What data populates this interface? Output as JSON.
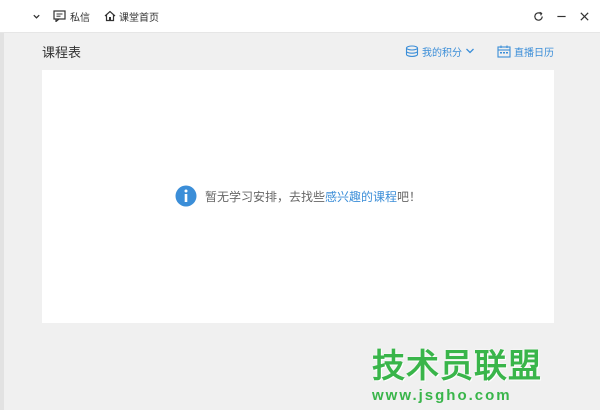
{
  "titlebar": {
    "messages_label": "私信",
    "home_label": "课堂首页",
    "icons": [
      "chevron-down-icon",
      "message-icon",
      "home-icon",
      "refresh-icon",
      "minimize-icon",
      "close-icon"
    ]
  },
  "header": {
    "title": "课程表",
    "points_label": "我的积分",
    "calendar_label": "直播日历"
  },
  "empty_state": {
    "text_before": "暂无学习安排，去找些",
    "link_text": "感兴趣的课程",
    "text_after": "吧！"
  },
  "watermark": {
    "title": "技术员联盟",
    "url": "www.jsgho.com"
  },
  "colors": {
    "accent": "#3b8ed8",
    "watermark": "#39b54a",
    "background": "#f0f0f0",
    "panel": "#ffffff"
  }
}
